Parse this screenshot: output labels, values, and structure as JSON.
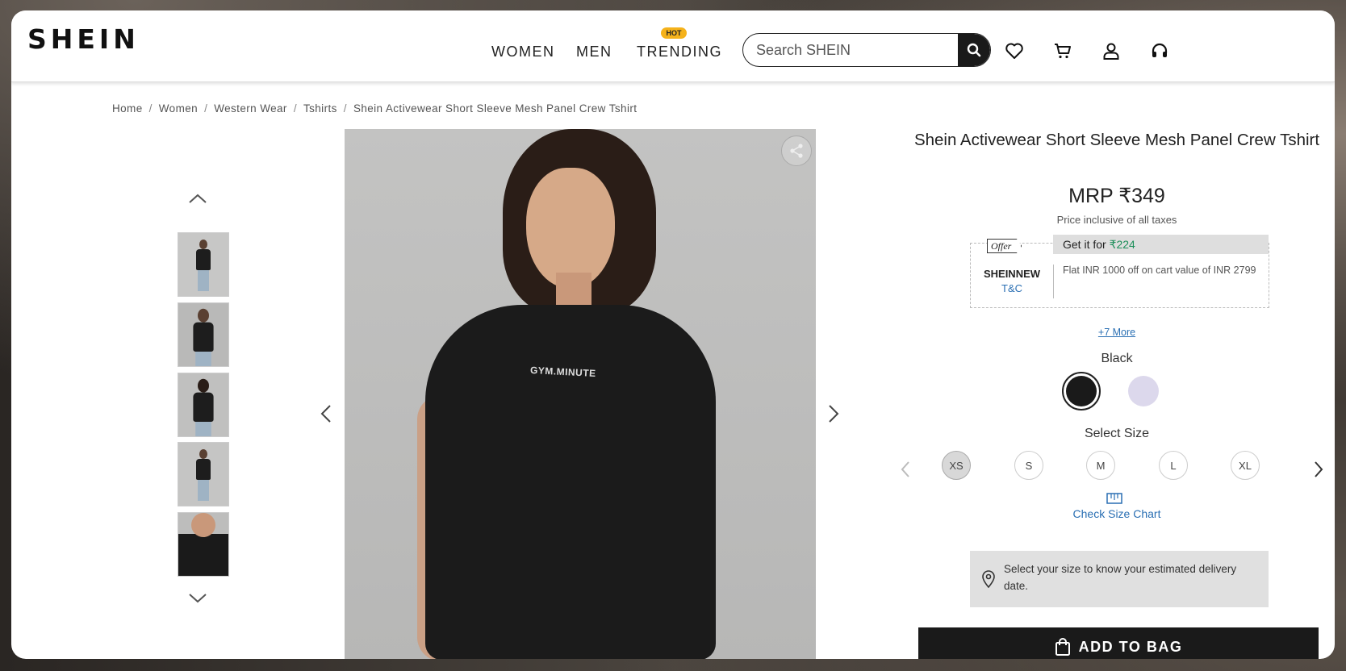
{
  "header": {
    "logo": "SHEIN",
    "nav": [
      "WOMEN",
      "MEN",
      "TRENDING"
    ],
    "hot_badge": "HOT",
    "search_placeholder": "Search SHEIN"
  },
  "breadcrumb": [
    "Home",
    "Women",
    "Western Wear",
    "Tshirts",
    "Shein Activewear Short Sleeve Mesh Panel Crew Tshirt"
  ],
  "gallery": {
    "print_text": "GYM.MINUTE"
  },
  "product": {
    "title": "Shein Activewear Short Sleeve Mesh Panel Crew Tshirt",
    "price": "MRP ₹349",
    "tax_note": "Price inclusive of all taxes",
    "offer": {
      "tag": "Offer",
      "get_label": "Get it for ",
      "get_amount": "₹224",
      "code": "SHEINNEW",
      "tnc": "T&C",
      "description": "Flat INR 1000 off on cart value of INR 2799"
    },
    "more_offers": "+7 More",
    "color_name": "Black",
    "colors": [
      "#1a1a1a",
      "#dcd8ec"
    ],
    "size_title": "Select Size",
    "sizes": [
      "XS",
      "S",
      "M",
      "L",
      "XL"
    ],
    "selected_size": "XS",
    "size_chart_link": "Check Size Chart",
    "delivery_text": "Select your size to know your estimated delivery date.",
    "add_to_bag": "ADD TO BAG"
  },
  "colors": {
    "accent_link": "#2a6fb3",
    "offer_price": "#1d8f5a",
    "hot_badge": "#f5b21b"
  }
}
